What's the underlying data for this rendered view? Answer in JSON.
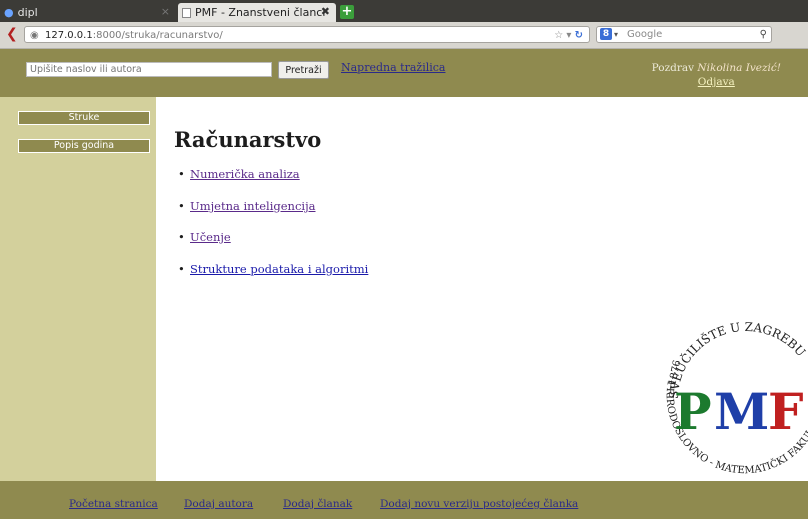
{
  "browser": {
    "tabs": [
      {
        "title": "dipl"
      },
      {
        "title": "PMF - Znanstveni članci"
      }
    ],
    "url": {
      "host": "127.0.0.1",
      "rest": ":8000/struka/racunarstvo/"
    },
    "search_engine": {
      "placeholder": "Google"
    }
  },
  "header": {
    "search_placeholder": "Upišite naslov ili autora",
    "search_button": "Pretraži",
    "advanced_search": "Napredna tražilica",
    "greeting": "Pozdrav",
    "user_name": "Nikolina Ivezić!",
    "logout": "Odjava"
  },
  "sidebar": {
    "items": [
      {
        "label": "Struke"
      },
      {
        "label": "Popis godina"
      }
    ]
  },
  "main": {
    "title": "Računarstvo",
    "topics": [
      {
        "label": "Numerička analiza",
        "visited": true
      },
      {
        "label": "Umjetna inteligencija",
        "visited": true
      },
      {
        "label": "Učenje",
        "visited": true
      },
      {
        "label": "Strukture podataka i algoritmi",
        "visited": false
      }
    ]
  },
  "seal": {
    "letters": "PMF",
    "top_text": "SVEUČILIŠTE U ZAGREBU",
    "bottom_text": "PRIRODOSLOVNO - MATEMATIČKI FAKULTET",
    "year": "1876"
  },
  "footer": {
    "links": [
      {
        "label": "Početna stranica"
      },
      {
        "label": "Dodaj autora"
      },
      {
        "label": "Dodaj članak"
      },
      {
        "label": "Dodaj novu verziju postojećeg članka"
      }
    ]
  },
  "colors": {
    "header": "#8f8a4f",
    "sidebar": "#d3d09c",
    "seal_p": "#1c7a2e",
    "seal_m": "#1f3fa8",
    "seal_f": "#c02020"
  }
}
